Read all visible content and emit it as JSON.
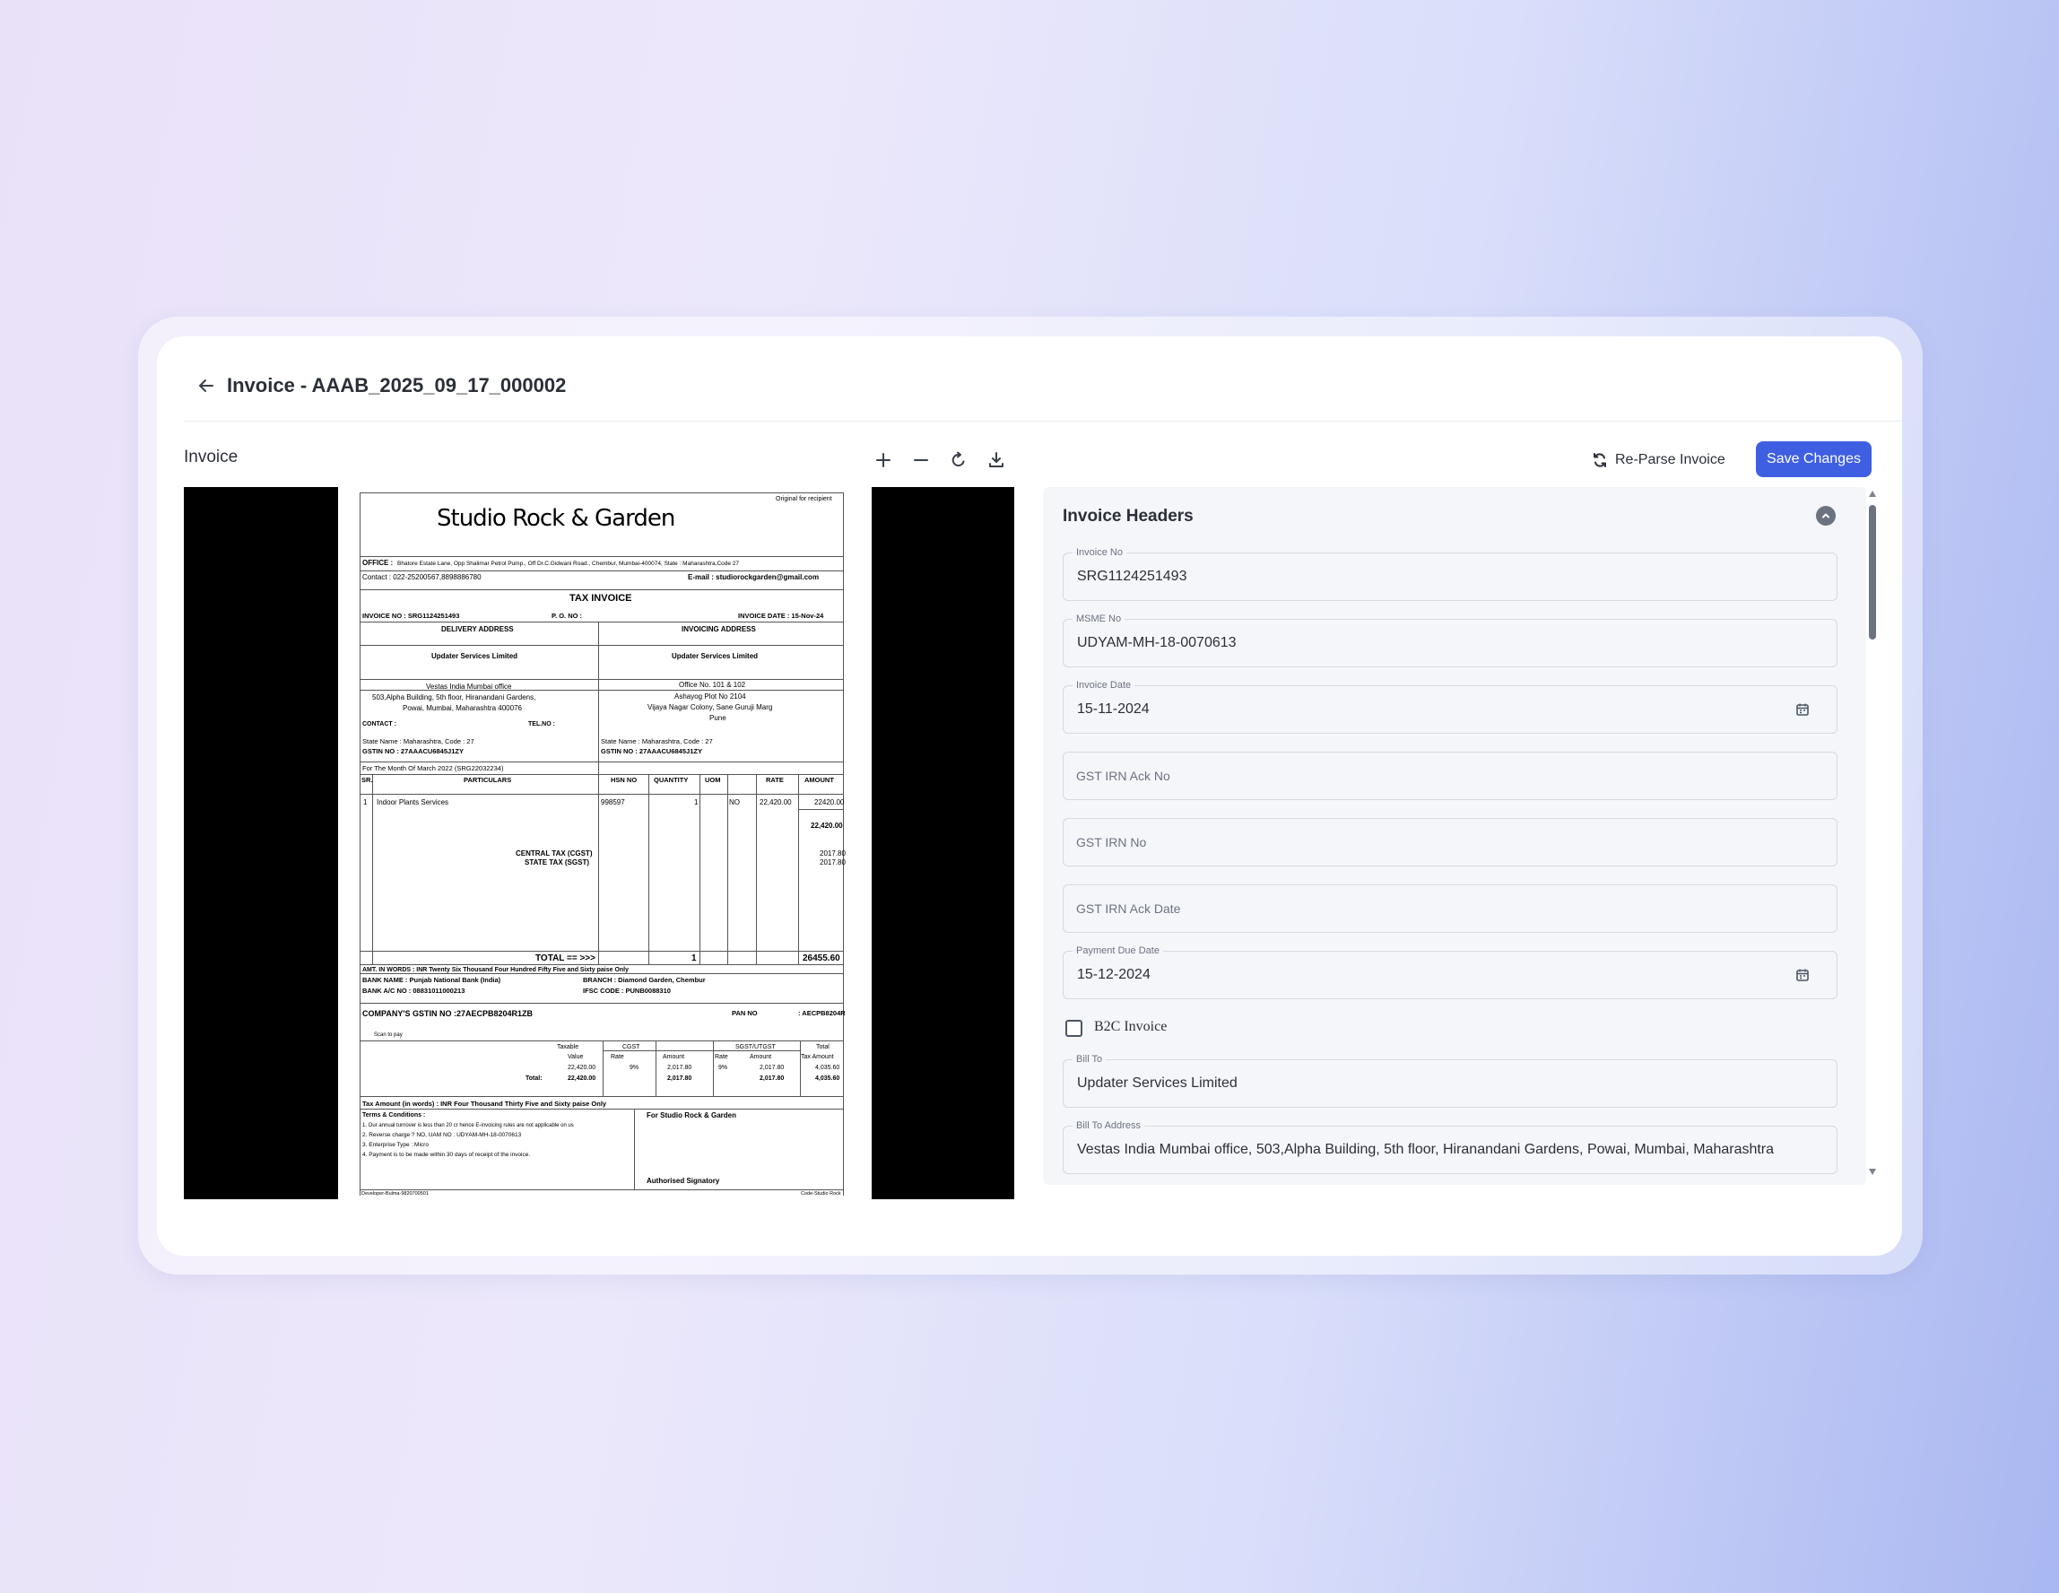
{
  "header": {
    "title": "Invoice - AAAB_2025_09_17_000002"
  },
  "viewer": {
    "title": "Invoice"
  },
  "actions": {
    "reparse_label": "Re-Parse Invoice",
    "save_label": "Save Changes"
  },
  "panel": {
    "title": "Invoice Headers",
    "fields": {
      "invoice_no": {
        "label": "Invoice No",
        "value": "SRG1124251493"
      },
      "msme_no": {
        "label": "MSME No",
        "value": "UDYAM-MH-18-0070613"
      },
      "invoice_date": {
        "label": "Invoice Date",
        "value": "15-11-2024"
      },
      "gst_irn_ack_no": {
        "placeholder": "GST IRN Ack No"
      },
      "gst_irn_no": {
        "placeholder": "GST IRN No"
      },
      "gst_irn_ack_date": {
        "placeholder": "GST IRN Ack Date"
      },
      "payment_due_date": {
        "label": "Payment Due Date",
        "value": "15-12-2024"
      },
      "b2c_invoice": {
        "label": "B2C Invoice",
        "checked": false
      },
      "bill_to": {
        "label": "Bill To",
        "value": "Updater Services Limited"
      },
      "bill_to_address": {
        "label": "Bill To Address",
        "value": "Vestas India Mumbai office, 503,Alpha Building, 5th floor, Hiranandani Gardens, Powai, Mumbai, Maharashtra"
      }
    }
  },
  "document": {
    "original_for": "Original for recipient",
    "company": "Studio Rock & Garden",
    "office_label": "OFFICE :",
    "office": "Bhatore Estate Lane, Opp Shalimar Petrol Pump., Off Dr.C.Gidwani Road., Chembur, Mumbai-400074, State : Maharashtra,Code 27",
    "contact": "Contact : 022-25200567,8898886780",
    "email": "E-mail : studiorockgarden@gmail.com",
    "tax_invoice": "TAX INVOICE",
    "invoice_no": "INVOICE NO  : SRG1124251493",
    "po_no": "P. O. NO       :",
    "invoice_date": "INVOICE DATE : 15-Nov-24",
    "delivery_address": "DELIVERY ADDRESS",
    "invoicing_address": "INVOICING ADDRESS",
    "party_left": "Updater Services Limited",
    "party_right": "Updater Services Limited",
    "addr_left_1": "Vestas India Mumbai office",
    "addr_left_2": "503,Alpha Building, 5th floor, Hiranandani Gardens,",
    "addr_left_3": "Powai, Mumbai, Maharashtra 400076",
    "addr_right_1": "Office No. 101 & 102",
    "addr_right_2": "Ashayog Plot No 2104",
    "addr_right_3": "Vijaya Nagar Colony, Sane Guruji Marg",
    "addr_right_4": "Pune",
    "contact_row": "CONTACT      :",
    "tel_no": "TEL.NO :",
    "state_left": "State Name         : Maharashtra, Code : 27",
    "gstin_left": "GSTIN NO : 27AAACU6845J1ZY",
    "state_right": "State Name         : Maharashtra, Code : 27",
    "gstin_right": "GSTIN NO : 27AAACU6845J1ZY",
    "month": "For The Month Of  March 2022 (SRG22032234)",
    "col_sr": "SR.",
    "col_particulars": "PARTICULARS",
    "col_hsn": "HSN NO",
    "col_qty": "QUANTITY",
    "col_uom": "UOM",
    "col_rate": "RATE",
    "col_amount": "AMOUNT",
    "row_sr": "1",
    "row_item": "Indoor Plants Services",
    "row_hsn": "998597",
    "row_qty": "1",
    "row_uom": "NO",
    "row_rate": "22,420.00",
    "row_amount": "22420.00",
    "subtotal": "22,420.00",
    "cgst_label": "CENTRAL TAX (CGST)",
    "sgst_label": "STATE TAX (SGST)",
    "cgst_amt": "2017.80",
    "sgst_amt": "2017.80",
    "total_label": "TOTAL  == >>>",
    "total_qty": "1",
    "total_amt": "26455.60",
    "amt_words": "AMT. IN WORDS   : INR Twenty Six Thousand Four Hundred Fifty Five and Sixty paise Only",
    "bank_name": "BANK NAME       : Punjab National Bank (India)",
    "bank_ac": "BANK A/C NO     : 08831011000213",
    "branch": "BRANCH            : Diamond Garden, Chembur",
    "ifsc": "IFSC CODE        : PUNB0088310",
    "company_gstin": "COMPANY'S  GSTIN NO  :27AECPB8204R1ZB",
    "pan_no": "PAN NO",
    "pan_val": ": AECPB8204R",
    "scan": "Scan to pay",
    "tt_taxable": "Taxable",
    "tt_value": "Value",
    "tt_cgst": "CGST",
    "tt_sgst": "SGST/UTGST",
    "tt_total": "Total",
    "tt_rate": "Rate",
    "tt_amount": "Amount",
    "tt_taxamount": "Tax Amount",
    "tt_r1_value": "22,420.00",
    "tt_r1_rate1": "9%",
    "tt_r1_amt1": "2,017.80",
    "tt_r1_rate2": "9%",
    "tt_r1_amt2": "2,017.80",
    "tt_r1_total": "4,035.60",
    "tt_total_label": "Total:",
    "tt_t_value": "22,420.00",
    "tt_t_amt1": "2,017.80",
    "tt_t_amt2": "2,017.80",
    "tt_t_total": "4,035.60",
    "tax_words": "Tax Amount (in words)  :   INR Four Thousand Thirty Five and Sixty paise Only",
    "terms_title": "Terms & Conditions :",
    "term1": "1. Our annual turnover is less than 20 cr hence E-invoicing rules are not applicable on us",
    "term2": "2. Reverse charge ? NO, UAM NO : UDYAM-MH-18-0070613",
    "term3": "3. Enterprise Type : Micro",
    "term4": "4. Payment is to be made within 30 days of receipt of the invoice.",
    "for_company": "For Studio Rock & Garden",
    "signatory": "Authorised Signatory",
    "developer": "Developer-Bulma-9820700501",
    "code": "Code-Studio Rock"
  }
}
